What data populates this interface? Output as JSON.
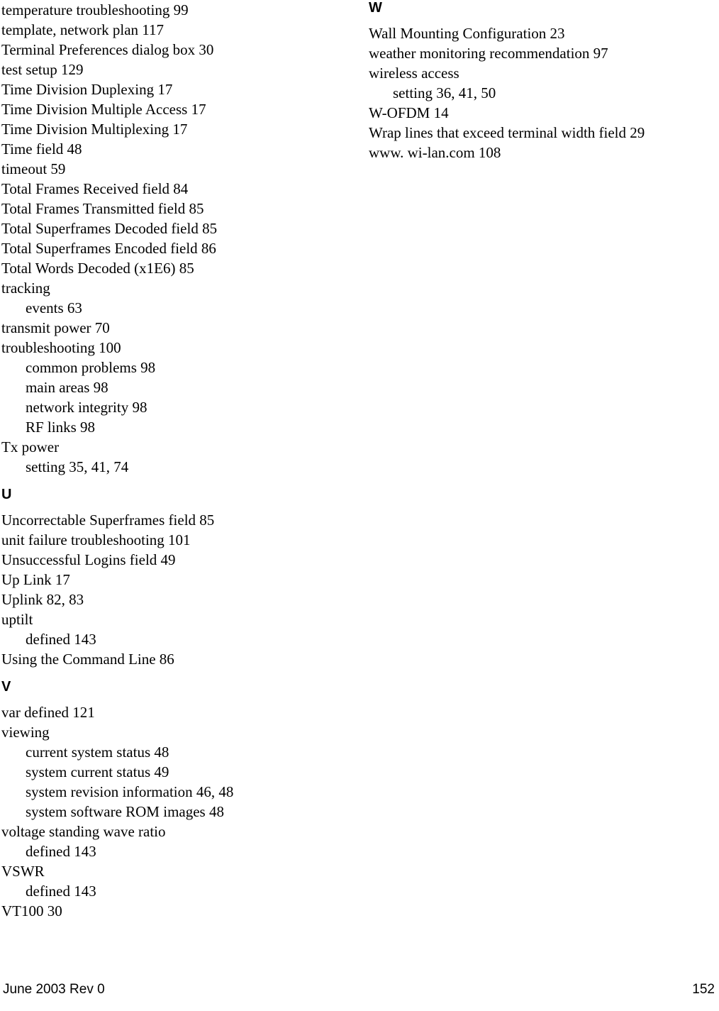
{
  "document": {
    "type": "index",
    "page_number": "152"
  },
  "footer": {
    "left_text": "June 2003 Rev 0",
    "right_text": "152"
  },
  "columns": [
    {
      "name": "left-column",
      "groups": [
        {
          "letter": "",
          "show_letter": false,
          "entries": [
            {
              "level": 1,
              "text": "temperature troubleshooting 99"
            },
            {
              "level": 1,
              "text": "template, network plan 117"
            },
            {
              "level": 1,
              "text": "Terminal Preferences dialog box 30"
            },
            {
              "level": 1,
              "text": "test setup 129"
            },
            {
              "level": 1,
              "text": "Time Division Duplexing 17"
            },
            {
              "level": 1,
              "text": "Time Division Multiple Access 17"
            },
            {
              "level": 1,
              "text": "Time Division Multiplexing 17"
            },
            {
              "level": 1,
              "text": "Time field 48"
            },
            {
              "level": 1,
              "text": "timeout 59"
            },
            {
              "level": 1,
              "text": "Total Frames Received field 84"
            },
            {
              "level": 1,
              "text": "Total Frames Transmitted field 85"
            },
            {
              "level": 1,
              "text": "Total Superframes Decoded field 85"
            },
            {
              "level": 1,
              "text": "Total Superframes Encoded field 86"
            },
            {
              "level": 1,
              "text": "Total Words Decoded (x1E6) 85"
            },
            {
              "level": 1,
              "text": "tracking"
            },
            {
              "level": 2,
              "text": "events 63"
            },
            {
              "level": 1,
              "text": "transmit power 70"
            },
            {
              "level": 1,
              "text": "troubleshooting 100"
            },
            {
              "level": 2,
              "text": "common problems 98"
            },
            {
              "level": 2,
              "text": "main areas 98"
            },
            {
              "level": 2,
              "text": "network integrity 98"
            },
            {
              "level": 2,
              "text": "RF links 98"
            },
            {
              "level": 1,
              "text": "Tx power"
            },
            {
              "level": 2,
              "text": "setting 35, 41, 74"
            }
          ]
        },
        {
          "letter": "U",
          "show_letter": true,
          "entries": [
            {
              "level": 1,
              "text": "Uncorrectable Superframes field 85"
            },
            {
              "level": 1,
              "text": "unit failure troubleshooting 101"
            },
            {
              "level": 1,
              "text": "Unsuccessful Logins field 49"
            },
            {
              "level": 1,
              "text": "Up Link 17"
            },
            {
              "level": 1,
              "text": "Uplink 82, 83"
            },
            {
              "level": 1,
              "text": "uptilt"
            },
            {
              "level": 2,
              "text": "defined 143"
            },
            {
              "level": 1,
              "text": "Using the Command Line 86"
            }
          ]
        },
        {
          "letter": "V",
          "show_letter": true,
          "entries": [
            {
              "level": 1,
              "text": "var defined 121"
            },
            {
              "level": 1,
              "text": "viewing"
            },
            {
              "level": 2,
              "text": "current system status 48"
            },
            {
              "level": 2,
              "text": "system current status 49"
            },
            {
              "level": 2,
              "text": "system revision information 46, 48"
            },
            {
              "level": 2,
              "text": "system software ROM images 48"
            },
            {
              "level": 1,
              "text": "voltage standing wave ratio"
            },
            {
              "level": 2,
              "text": "defined 143"
            },
            {
              "level": 1,
              "text": "VSWR"
            },
            {
              "level": 2,
              "text": "defined 143"
            },
            {
              "level": 1,
              "text": "VT100 30"
            }
          ]
        }
      ]
    },
    {
      "name": "right-column",
      "groups": [
        {
          "letter": "W",
          "show_letter": true,
          "entries": [
            {
              "level": 1,
              "text": "Wall Mounting Configuration 23"
            },
            {
              "level": 1,
              "text": "weather monitoring recommendation 97"
            },
            {
              "level": 1,
              "text": "wireless access"
            },
            {
              "level": 2,
              "text": "setting 36, 41, 50"
            },
            {
              "level": 1,
              "text": "W-OFDM 14"
            },
            {
              "level": 1,
              "text": "Wrap lines that exceed terminal width field 29"
            },
            {
              "level": 1,
              "text": "www. wi-lan.com 108"
            }
          ]
        }
      ]
    }
  ]
}
